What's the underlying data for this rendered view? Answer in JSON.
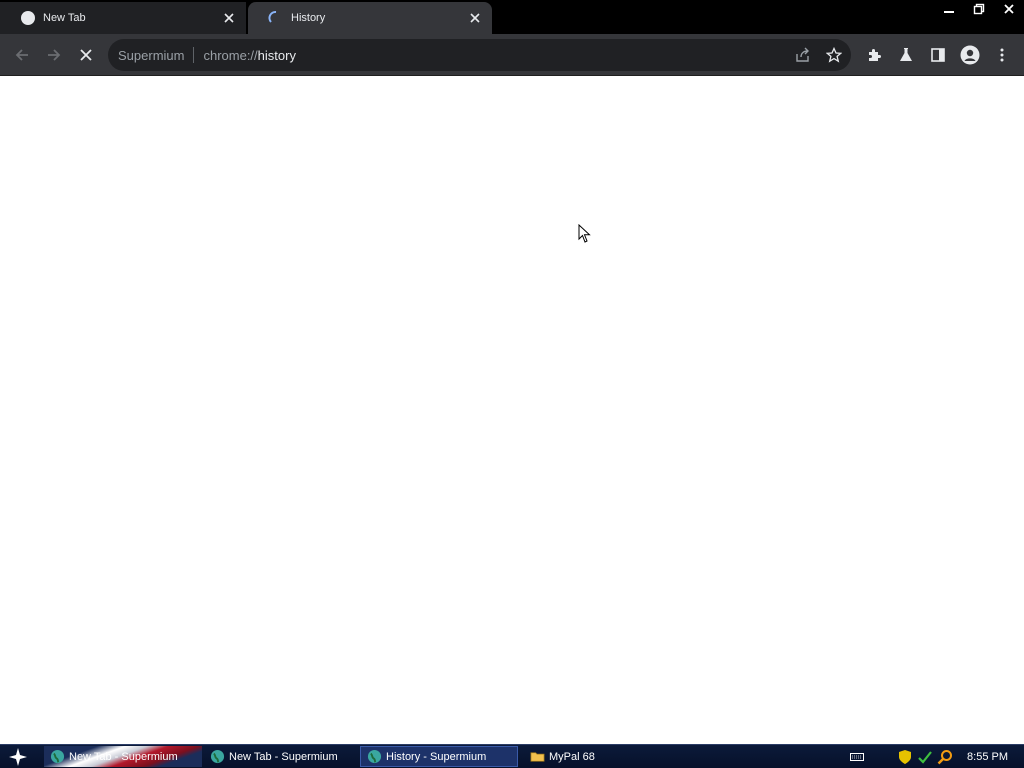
{
  "window": {
    "tabs": [
      {
        "title": "New Tab",
        "active": false
      },
      {
        "title": "History",
        "active": true,
        "loading": true
      }
    ]
  },
  "toolbar": {
    "omnibox_prefix": "Supermium",
    "url_scheme": "chrome://",
    "url_path": "history"
  },
  "taskbar": {
    "tasks": [
      {
        "label": "New Tab - Supermium"
      },
      {
        "label": "New Tab - Supermium"
      },
      {
        "label": "History - Supermium",
        "active": true
      },
      {
        "label": "MyPal 68"
      }
    ],
    "clock": "8:55 PM"
  },
  "colors": {
    "tabstrip": "#000000",
    "toolbar": "#35363a",
    "omnibox": "#202124",
    "content": "#ffffff",
    "taskbar": "#0b1a3a"
  }
}
